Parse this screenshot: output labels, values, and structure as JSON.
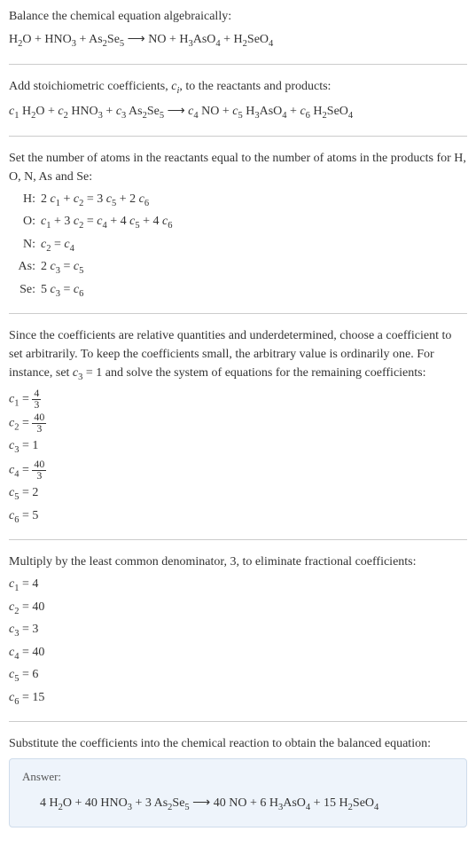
{
  "intro": {
    "line1": "Balance the chemical equation algebraically:",
    "reaction": "H₂O + HNO₃ + As₂Se₅ ⟶ NO + H₃AsO₄ + H₂SeO₄"
  },
  "stoich": {
    "prompt": "Add stoichiometric coefficients, c_i, to the reactants and products:",
    "equation": "c₁ H₂O + c₂ HNO₃ + c₃ As₂Se₅ ⟶ c₄ NO + c₅ H₃AsO₄ + c₆ H₂SeO₄"
  },
  "atoms": {
    "prompt": "Set the number of atoms in the reactants equal to the number of atoms in the products for H, O, N, As and Se:",
    "rows": [
      {
        "el": "H:",
        "eq": "2 c₁ + c₂ = 3 c₅ + 2 c₆"
      },
      {
        "el": "O:",
        "eq": "c₁ + 3 c₂ = c₄ + 4 c₅ + 4 c₆"
      },
      {
        "el": "N:",
        "eq": "c₂ = c₄"
      },
      {
        "el": "As:",
        "eq": "2 c₃ = c₅"
      },
      {
        "el": "Se:",
        "eq": "5 c₃ = c₆"
      }
    ]
  },
  "solve": {
    "prompt": "Since the coefficients are relative quantities and underdetermined, choose a coefficient to set arbitrarily. To keep the coefficients small, the arbitrary value is ordinarily one. For instance, set c₃ = 1 and solve the system of equations for the remaining coefficients:",
    "coefs": [
      {
        "lhs": "c₁ =",
        "num": "4",
        "den": "3"
      },
      {
        "lhs": "c₂ =",
        "num": "40",
        "den": "3"
      },
      {
        "lhs": "c₃ =",
        "val": "1"
      },
      {
        "lhs": "c₄ =",
        "num": "40",
        "den": "3"
      },
      {
        "lhs": "c₅ =",
        "val": "2"
      },
      {
        "lhs": "c₆ =",
        "val": "5"
      }
    ]
  },
  "multiply": {
    "prompt": "Multiply by the least common denominator, 3, to eliminate fractional coefficients:",
    "coefs": [
      {
        "lhs": "c₁ =",
        "val": "4"
      },
      {
        "lhs": "c₂ =",
        "val": "40"
      },
      {
        "lhs": "c₃ =",
        "val": "3"
      },
      {
        "lhs": "c₄ =",
        "val": "40"
      },
      {
        "lhs": "c₅ =",
        "val": "6"
      },
      {
        "lhs": "c₆ =",
        "val": "15"
      }
    ]
  },
  "substitute": {
    "prompt": "Substitute the coefficients into the chemical reaction to obtain the balanced equation:"
  },
  "answer": {
    "label": "Answer:",
    "equation": "4 H₂O + 40 HNO₃ + 3 As₂Se₅ ⟶ 40 NO + 6 H₃AsO₄ + 15 H₂SeO₄"
  }
}
